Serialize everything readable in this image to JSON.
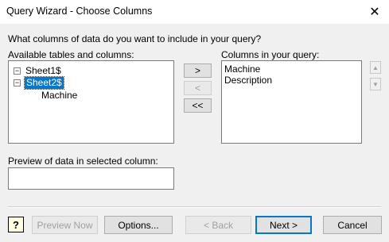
{
  "window": {
    "title": "Query Wizard - Choose Columns",
    "close_icon": "close-icon"
  },
  "prompt": "What columns of data do you want to include in your query?",
  "available": {
    "label": "Available tables and columns:",
    "tree": [
      {
        "label": "Sheet1$",
        "expander": "−",
        "level": 0,
        "selected": false
      },
      {
        "label": "Sheet2$",
        "expander": "−",
        "level": 0,
        "selected": true
      },
      {
        "label": "Machine",
        "expander": "",
        "level": 1,
        "selected": false
      }
    ]
  },
  "move_buttons": {
    "add": ">",
    "remove": "<",
    "remove_all": "<<"
  },
  "query_columns": {
    "label": "Columns in your query:",
    "items": [
      "Machine",
      "Description"
    ]
  },
  "order_buttons": {
    "up_icon": "up-arrow-icon",
    "down_icon": "down-arrow-icon"
  },
  "preview": {
    "label": "Preview of data in selected column:",
    "value": ""
  },
  "footer": {
    "help_glyph": "?",
    "preview_now": "Preview Now",
    "options": "Options...",
    "back": "< Back",
    "next": "Next >",
    "cancel": "Cancel"
  }
}
